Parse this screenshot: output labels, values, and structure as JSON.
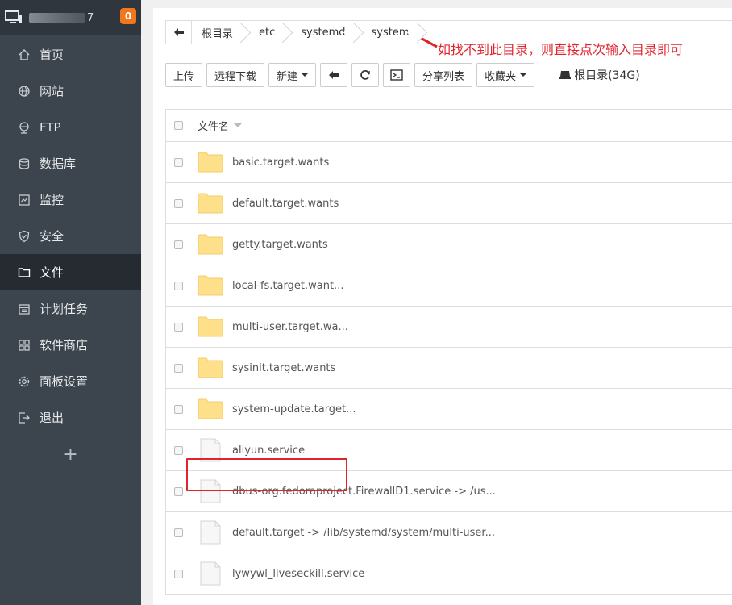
{
  "sidebar": {
    "host_suffix": "7",
    "badge": "0",
    "items": [
      {
        "label": "首页",
        "icon": "home-icon"
      },
      {
        "label": "网站",
        "icon": "globe-icon"
      },
      {
        "label": "FTP",
        "icon": "ftp-icon"
      },
      {
        "label": "数据库",
        "icon": "database-icon"
      },
      {
        "label": "监控",
        "icon": "monitor-chart-icon"
      },
      {
        "label": "安全",
        "icon": "shield-icon"
      },
      {
        "label": "文件",
        "icon": "folder-icon",
        "active": true
      },
      {
        "label": "计划任务",
        "icon": "calendar-icon"
      },
      {
        "label": "软件商店",
        "icon": "grid-icon"
      },
      {
        "label": "面板设置",
        "icon": "gear-icon"
      },
      {
        "label": "退出",
        "icon": "logout-icon"
      }
    ],
    "add_label": "+"
  },
  "breadcrumb": {
    "items": [
      "根目录",
      "etc",
      "systemd",
      "system"
    ]
  },
  "annotation": "如找不到此目录，则直接点次输入目录即可",
  "toolbar": {
    "upload": "上传",
    "remote_download": "远程下载",
    "new": "新建",
    "share_list": "分享列表",
    "favorites": "收藏夹",
    "disk": "根目录(34G)"
  },
  "file_list": {
    "header": "文件名",
    "files": [
      {
        "name": "basic.target.wants",
        "type": "folder"
      },
      {
        "name": "default.target.wants",
        "type": "folder"
      },
      {
        "name": "getty.target.wants",
        "type": "folder"
      },
      {
        "name": "local-fs.target.want...",
        "type": "folder"
      },
      {
        "name": "multi-user.target.wa...",
        "type": "folder"
      },
      {
        "name": "sysinit.target.wants",
        "type": "folder"
      },
      {
        "name": "system-update.target...",
        "type": "folder"
      },
      {
        "name": "aliyun.service",
        "type": "file"
      },
      {
        "name": "dbus-org.fedoraproject.FirewallD1.service -> /us...",
        "type": "file"
      },
      {
        "name": "default.target -> /lib/systemd/system/multi-user...",
        "type": "file"
      },
      {
        "name": "lywywl_liveseckill.service",
        "type": "file",
        "highlighted": true
      }
    ]
  },
  "colors": {
    "sidebar_bg": "#3c444d",
    "sidebar_active": "#252b31",
    "badge": "#f0771c",
    "annotation_red": "#e0242e",
    "folder_yellow": "#ffe08a"
  }
}
